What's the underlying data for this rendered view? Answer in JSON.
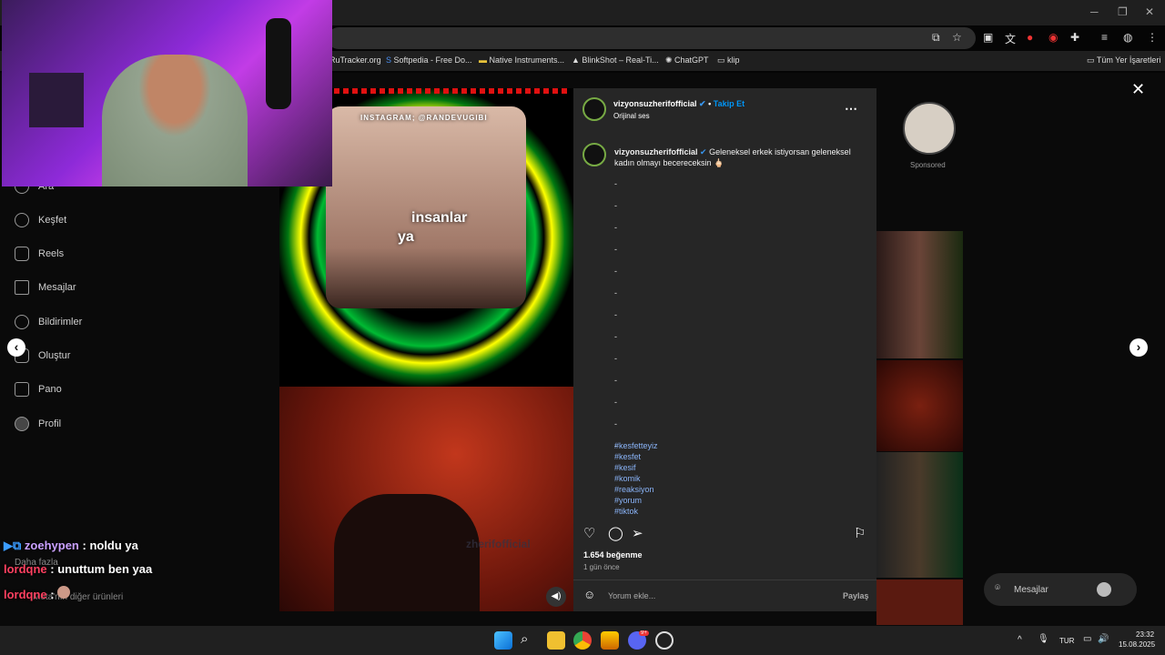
{
  "browser": {
    "bookmarks": [
      "RuTracker.org",
      "Softpedia - Free Do...",
      "Native Instruments...",
      "BlinkShot – Real-Ti...",
      "ChatGPT",
      "klip"
    ],
    "all_bookmarks": "Tüm Yer İşaretleri"
  },
  "sidebar": {
    "items": [
      {
        "label": "Ara",
        "icon": "search-icon"
      },
      {
        "label": "Keşfet",
        "icon": "compass-icon"
      },
      {
        "label": "Reels",
        "icon": "reels-icon"
      },
      {
        "label": "Mesajlar",
        "icon": "send-icon"
      },
      {
        "label": "Bildirimler",
        "icon": "heart-icon"
      },
      {
        "label": "Oluştur",
        "icon": "plus-icon"
      },
      {
        "label": "Pano",
        "icon": "dashboard-icon"
      },
      {
        "label": "Profil",
        "icon": "profile-icon"
      }
    ],
    "more": "Daha fazla",
    "meta": "Meta'nın diğer ürünleri"
  },
  "video": {
    "watermark": "INSTAGRAM; @RANDEVUGIBI",
    "subtitle_line1": "insanlar",
    "subtitle_line2": "ya",
    "bottom_watermark": "zherifofficial"
  },
  "post": {
    "username": "vizyonsuzherifofficial",
    "follow_label": "Takip Et",
    "audio": "Orijinal ses",
    "caption_username": "vizyonsuzherifofficial",
    "caption": "Geleneksel erkek istiyorsan geleneksel kadın olmayı becereceksin 🖕🏻",
    "dashes": [
      "-",
      "-",
      "-",
      "-",
      "-",
      "-",
      "-",
      "-",
      "-",
      "-",
      "-",
      "-",
      "-"
    ],
    "hashtags": [
      "#kesfetteyiz",
      "#kesfet",
      "#kesif",
      "#komik",
      "#reaksiyon",
      "#yorum",
      "#tiktok"
    ],
    "likes": "1.654 beğenme",
    "time": "1 gün önce",
    "comment_placeholder": "Yorum ekle...",
    "share": "Paylaş"
  },
  "right_preview": {
    "sponsored": "Sponsored",
    "messages": "Mesajlar"
  },
  "chat": [
    {
      "user": "zoehypen",
      "text": ": noldu ya",
      "color": "#c9a0ff"
    },
    {
      "user": "lordqne",
      "text": ": unuttum ben yaa",
      "color": "#ff4060"
    },
    {
      "user": "lordqne",
      "text": ":",
      "color": "#ff4060"
    }
  ],
  "taskbar": {
    "lang": "TUR",
    "time": "23:32",
    "date": "15.08.2025",
    "discord_badge": "9+"
  }
}
